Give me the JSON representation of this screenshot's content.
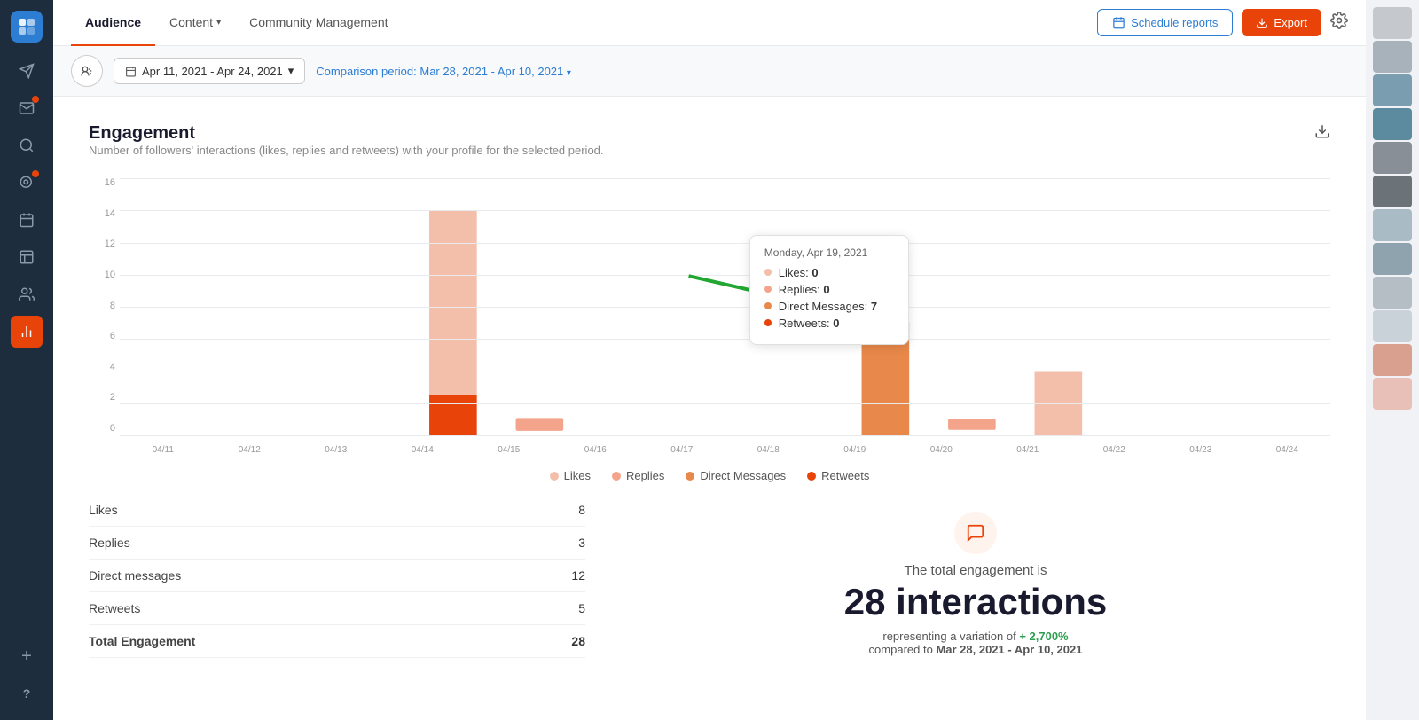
{
  "sidebar": {
    "logo_icon": "◈",
    "icons": [
      {
        "name": "paper-plane-icon",
        "glyph": "✈",
        "active": false,
        "badge": false
      },
      {
        "name": "compose-icon",
        "glyph": "✏",
        "active": false,
        "badge": true
      },
      {
        "name": "search-icon",
        "glyph": "🔍",
        "active": false,
        "badge": false
      },
      {
        "name": "calendar-icon",
        "glyph": "📅",
        "active": false,
        "badge": false
      },
      {
        "name": "schedule-icon",
        "glyph": "📋",
        "active": false,
        "badge": false
      },
      {
        "name": "team-icon",
        "glyph": "👥",
        "active": false,
        "badge": false
      },
      {
        "name": "analytics-icon",
        "glyph": "📊",
        "active": true,
        "badge": false
      }
    ],
    "bottom_icons": [
      {
        "name": "add-icon",
        "glyph": "+",
        "active": false
      },
      {
        "name": "help-icon",
        "glyph": "?",
        "active": false
      }
    ]
  },
  "color_swatches": [
    "#c5c9cd",
    "#a8b2ba",
    "#7b9db0",
    "#5c8a9e",
    "#888f96",
    "#6b7278",
    "#a9bbc5",
    "#8fa3ae",
    "#b5bec4",
    "#c8d2d8",
    "#d9a090",
    "#e8c0b8"
  ],
  "top_nav": {
    "tabs": [
      {
        "label": "Audience",
        "active": true
      },
      {
        "label": "Content",
        "active": false,
        "has_chevron": true
      },
      {
        "label": "Community Management",
        "active": false
      }
    ],
    "schedule_reports_label": "Schedule reports",
    "export_label": "Export",
    "settings_icon": "⚙"
  },
  "filter_bar": {
    "date_range": "Apr 11, 2021 - Apr 24, 2021",
    "comparison_label": "Comparison period:",
    "comparison_date": "Mar 28, 2021 - Apr 10, 2021"
  },
  "engagement_section": {
    "title": "Engagement",
    "description": "Number of followers' interactions (likes, replies and retweets) with your profile for the selected period.",
    "y_labels": [
      "16",
      "14",
      "12",
      "10",
      "8",
      "6",
      "4",
      "2",
      "0"
    ],
    "x_labels": [
      "04/11",
      "04/12",
      "04/13",
      "04/14",
      "04/15",
      "04/16",
      "04/17",
      "04/18",
      "04/19",
      "04/20",
      "04/21",
      "04/22",
      "04/23",
      "04/24"
    ],
    "legend": [
      {
        "label": "Likes",
        "color": "#f4bfaa"
      },
      {
        "label": "Replies",
        "color": "#f4a48a"
      },
      {
        "label": "Direct Messages",
        "color": "#e8884a"
      },
      {
        "label": "Retweets",
        "color": "#e8440a"
      }
    ],
    "tooltip": {
      "date": "Monday, Apr 19, 2021",
      "rows": [
        {
          "label": "Likes:",
          "value": "0",
          "color": "#f4bfaa"
        },
        {
          "label": "Replies:",
          "value": "0",
          "color": "#f4a48a"
        },
        {
          "label": "Direct Messages:",
          "value": "7",
          "color": "#e8884a"
        },
        {
          "label": "Retweets:",
          "value": "0",
          "color": "#e8440a"
        }
      ]
    },
    "stats": [
      {
        "label": "Likes",
        "value": "8"
      },
      {
        "label": "Replies",
        "value": "3"
      },
      {
        "label": "Direct messages",
        "value": "12"
      },
      {
        "label": "Retweets",
        "value": "5"
      },
      {
        "label": "Total Engagement",
        "value": "28",
        "is_total": true
      }
    ],
    "summary": {
      "intro": "The total engagement is",
      "number": "28 interactions",
      "variation_prefix": "representing a variation of",
      "variation_value": "+ 2,700%",
      "comparison_prefix": "compared to",
      "comparison_date": "Mar 28, 2021 - Apr 10, 2021"
    }
  }
}
